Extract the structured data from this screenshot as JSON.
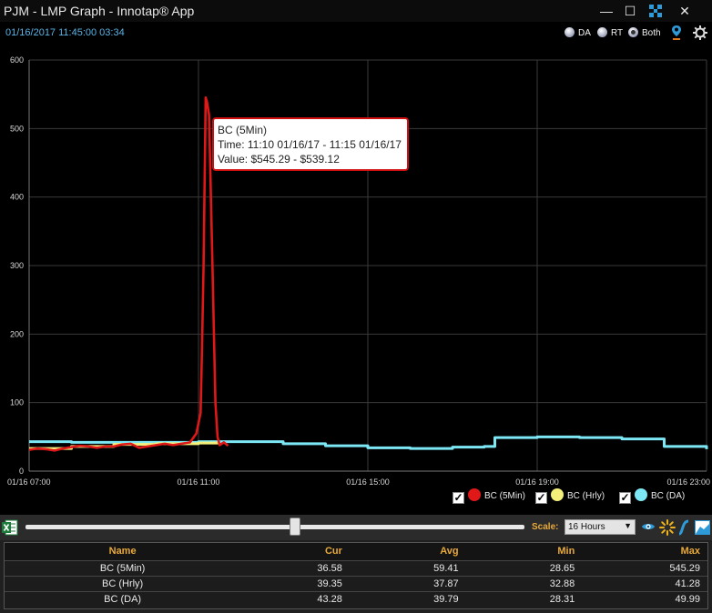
{
  "window": {
    "title": "PJM - LMP Graph - Innotap® App",
    "minimize_label": "—",
    "maximize_label": "☐",
    "close_label": "✕"
  },
  "header": {
    "timestamp": "01/16/2017 11:45:00  03:34",
    "radios": [
      {
        "label": "DA",
        "selected": false
      },
      {
        "label": "RT",
        "selected": false
      },
      {
        "label": "Both",
        "selected": true
      }
    ]
  },
  "chart_data": {
    "type": "line",
    "ylim": [
      0,
      600
    ],
    "yticks": [
      "0",
      "100",
      "200",
      "300",
      "400",
      "500",
      "600"
    ],
    "xlim_hours": [
      7,
      23
    ],
    "xticks": [
      {
        "label": "01/16 07:00",
        "hour": 7
      },
      {
        "label": "01/16 11:00",
        "hour": 11
      },
      {
        "label": "01/16 15:00",
        "hour": 15
      },
      {
        "label": "01/16 19:00",
        "hour": 19
      },
      {
        "label": "01/16 23:00",
        "hour": 23
      }
    ],
    "grid": true,
    "series": [
      {
        "name": "BC (DA)",
        "color": "#7de8f5",
        "step": true,
        "points": [
          [
            7,
            43
          ],
          [
            8,
            42
          ],
          [
            9,
            42
          ],
          [
            10,
            42
          ],
          [
            11,
            43
          ],
          [
            12,
            43
          ],
          [
            13,
            40
          ],
          [
            14,
            37
          ],
          [
            15,
            34
          ],
          [
            16,
            33
          ],
          [
            17,
            35
          ],
          [
            17.75,
            36
          ],
          [
            18,
            49
          ],
          [
            19,
            50
          ],
          [
            20,
            49
          ],
          [
            21,
            47
          ],
          [
            22,
            36
          ],
          [
            23,
            32
          ]
        ]
      },
      {
        "name": "BC (Hrly)",
        "color": "#f5f07a",
        "step": true,
        "points": [
          [
            7,
            33
          ],
          [
            8,
            36
          ],
          [
            9,
            39
          ],
          [
            10,
            40
          ],
          [
            11,
            41
          ],
          [
            11.5,
            41
          ]
        ]
      },
      {
        "name": "BC (5Min)",
        "color": "#e01818",
        "step": false,
        "points": [
          [
            7,
            31
          ],
          [
            7.2,
            33
          ],
          [
            7.4,
            32
          ],
          [
            7.6,
            30
          ],
          [
            7.8,
            33
          ],
          [
            8,
            35
          ],
          [
            8.2,
            37
          ],
          [
            8.4,
            36
          ],
          [
            8.6,
            34
          ],
          [
            8.8,
            36
          ],
          [
            9,
            36
          ],
          [
            9.2,
            39
          ],
          [
            9.4,
            40
          ],
          [
            9.6,
            34
          ],
          [
            9.8,
            36
          ],
          [
            10,
            38
          ],
          [
            10.2,
            40
          ],
          [
            10.4,
            38
          ],
          [
            10.6,
            40
          ],
          [
            10.8,
            42
          ],
          [
            10.95,
            55
          ],
          [
            11.05,
            85
          ],
          [
            11.08,
            170
          ],
          [
            11.12,
            300
          ],
          [
            11.17,
            545.29
          ],
          [
            11.2,
            539.12
          ],
          [
            11.25,
            520
          ],
          [
            11.33,
            300
          ],
          [
            11.4,
            100
          ],
          [
            11.45,
            50
          ],
          [
            11.5,
            38
          ],
          [
            11.6,
            42
          ],
          [
            11.7,
            37
          ]
        ]
      }
    ]
  },
  "tooltip": {
    "series": "BC (5Min)",
    "time": "Time: 11:10 01/16/17 - 11:15 01/16/17",
    "value": "Value: $545.29 - $539.12"
  },
  "legend": [
    {
      "label": "BC (5Min)",
      "color": "#e01818",
      "checked": true
    },
    {
      "label": "BC (Hrly)",
      "color": "#f5f07a",
      "checked": true
    },
    {
      "label": "BC (DA)",
      "color": "#7de8f5",
      "checked": true
    }
  ],
  "toolbar": {
    "scale_label": "Scale:",
    "scale_value": "16 Hours",
    "slider_position": 0.54
  },
  "stats": {
    "columns": [
      "Name",
      "Cur",
      "Avg",
      "Min",
      "Max"
    ],
    "rows": [
      [
        "BC (5Min)",
        "36.58",
        "59.41",
        "28.65",
        "545.29"
      ],
      [
        "BC (Hrly)",
        "39.35",
        "37.87",
        "32.88",
        "41.28"
      ],
      [
        "BC (DA)",
        "43.28",
        "39.79",
        "28.31",
        "49.99"
      ]
    ]
  }
}
